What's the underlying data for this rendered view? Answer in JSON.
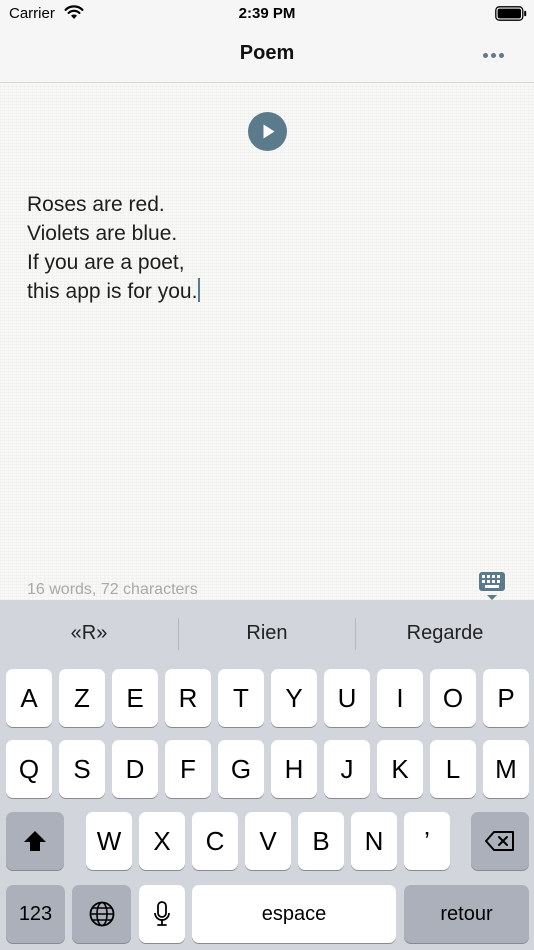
{
  "status_bar": {
    "carrier": "Carrier",
    "time": "2:39 PM",
    "wifi_icon": "wifi-icon",
    "battery_icon": "battery-icon"
  },
  "nav": {
    "title": "Poem",
    "more_icon": "more-horizontal-icon"
  },
  "editor": {
    "play_icon": "play-icon",
    "lines": [
      "Roses are red.",
      "Violets are blue.",
      "If you are a poet,",
      "this app is for you."
    ],
    "stats": "16 words, 72 characters",
    "keyboard_toggle_icon": "keyboard-dismiss-icon"
  },
  "keyboard": {
    "suggestions": [
      "«R»",
      "Rien",
      "Regarde"
    ],
    "row1": [
      "A",
      "Z",
      "E",
      "R",
      "T",
      "Y",
      "U",
      "I",
      "O",
      "P"
    ],
    "row2": [
      "Q",
      "S",
      "D",
      "F",
      "G",
      "H",
      "J",
      "K",
      "L",
      "M"
    ],
    "row3": [
      "W",
      "X",
      "C",
      "V",
      "B",
      "N",
      "’"
    ],
    "numbers_label": "123",
    "space_label": "espace",
    "return_label": "retour",
    "shift_icon": "shift-icon",
    "delete_icon": "delete-icon",
    "globe_icon": "globe-icon",
    "mic_icon": "microphone-icon"
  },
  "colors": {
    "accent": "#5b7b8c",
    "keyboard_bg": "#d2d5db",
    "special_key": "#abb0bb"
  }
}
